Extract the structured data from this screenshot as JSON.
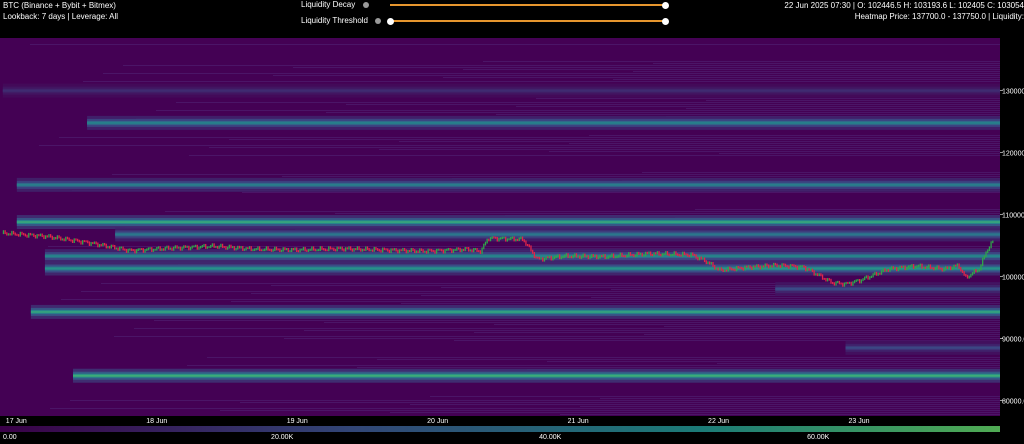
{
  "header": {
    "symbol": "BTC (Binance + Bybit + Bitmex)",
    "lookback": "Lookback: 7 days | Leverage: All",
    "ohlc": "22 Jun 2025 07:30 | O: 102446.5 H: 103193.6 L: 102405 C: 103054",
    "heatmap_info": "Heatmap Price: 137700.0 - 137750.0 | Liquidity:"
  },
  "controls": {
    "decay_label": "Liquidity Decay",
    "threshold_label": "Liquidity Threshold",
    "decay_value": 1.0,
    "threshold_value": 0.0,
    "track_color": "#e6962e",
    "info_icon": "info-icon"
  },
  "chart_data": {
    "type": "heatmap",
    "x_ticks": [
      "17 Jun",
      "18 Jun",
      "19 Jun",
      "20 Jun",
      "21 Jun",
      "22 Jun",
      "23 Jun"
    ],
    "y_ticks": [
      "130000.0",
      "120000.0",
      "110000.0",
      "100000.0",
      "90000.0",
      "80000.0"
    ],
    "y_tick_values": [
      130000,
      120000,
      110000,
      100000,
      90000,
      80000
    ],
    "xlim_days": [
      16.98,
      24.1
    ],
    "ylim": [
      77500,
      138500
    ],
    "colorscale": [
      "#440154",
      "#3b528b",
      "#21918c",
      "#5ec962"
    ],
    "legend_ticks": [
      "0.00",
      "20.00K",
      "40.00K",
      "60.00K"
    ],
    "legend_tick_values": [
      0,
      20000,
      40000,
      60000
    ],
    "legend_max": 72000,
    "bands": [
      {
        "price": 84000,
        "start_day": 17.5,
        "intensity": 0.85
      },
      {
        "price": 94300,
        "start_day": 17.2,
        "intensity": 0.78
      },
      {
        "price": 101300,
        "start_day": 17.3,
        "intensity": 0.7
      },
      {
        "price": 103300,
        "start_day": 17.3,
        "intensity": 0.62
      },
      {
        "price": 108800,
        "start_day": 17.1,
        "intensity": 0.8
      },
      {
        "price": 106800,
        "start_day": 17.8,
        "intensity": 0.55
      },
      {
        "price": 114800,
        "start_day": 17.1,
        "intensity": 0.58
      },
      {
        "price": 124800,
        "start_day": 17.6,
        "intensity": 0.6
      },
      {
        "price": 130000,
        "start_day": 17.0,
        "intensity": 0.18
      },
      {
        "price": 88500,
        "start_day": 23.0,
        "intensity": 0.3
      },
      {
        "price": 98000,
        "start_day": 22.5,
        "intensity": 0.32
      }
    ],
    "price_series": {
      "days": [
        17.0,
        17.3,
        17.6,
        17.9,
        18.2,
        18.5,
        18.8,
        19.1,
        19.4,
        19.7,
        20.0,
        20.3,
        20.4,
        20.45,
        20.7,
        20.8,
        21.0,
        21.3,
        21.6,
        21.9,
        22.0,
        22.1,
        22.3,
        22.5,
        22.6,
        22.7,
        22.9,
        23.0,
        23.1,
        23.3,
        23.5,
        23.7,
        23.8,
        23.85,
        23.95,
        24.0,
        24.05
      ],
      "prices": [
        107000,
        106500,
        105500,
        104200,
        104600,
        104900,
        104400,
        104300,
        104500,
        104300,
        104100,
        104400,
        104100,
        106200,
        106000,
        102800,
        103300,
        103200,
        103700,
        103500,
        102500,
        101000,
        101500,
        101800,
        101700,
        101500,
        99000,
        98800,
        99400,
        101200,
        101700,
        101200,
        101800,
        99800,
        101300,
        104200,
        105800
      ]
    }
  }
}
